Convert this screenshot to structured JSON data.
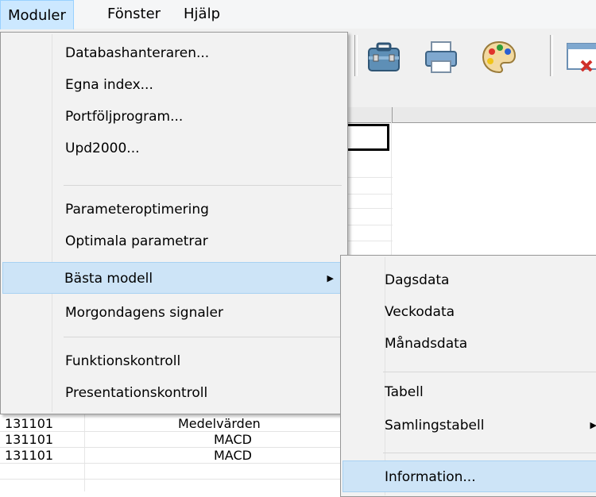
{
  "menubar": {
    "items": [
      {
        "label": "Moduler",
        "active": true
      },
      {
        "label": "Fönster",
        "active": false
      },
      {
        "label": "Hjälp",
        "active": false
      }
    ]
  },
  "toolbar": {
    "icons": [
      "toolbox-icon",
      "printer-icon",
      "palette-icon",
      "window-close-icon"
    ]
  },
  "dropdown": {
    "items": [
      {
        "label": "Databashanteraren..."
      },
      {
        "label": "Egna index..."
      },
      {
        "label": "Portföljprogram..."
      },
      {
        "label": "Upd2000..."
      },
      {
        "label": "Parameteroptimering"
      },
      {
        "label": "Optimala parametrar"
      },
      {
        "label": "Bästa modell",
        "highlighted": true,
        "has_submenu": true
      },
      {
        "label": "Morgondagens signaler"
      },
      {
        "label": "Funktionskontroll"
      },
      {
        "label": "Presentationskontroll"
      }
    ]
  },
  "submenu": {
    "items": [
      {
        "label": "Dagsdata"
      },
      {
        "label": "Veckodata"
      },
      {
        "label": "Månadsdata"
      },
      {
        "label": "Tabell"
      },
      {
        "label": "Samlingstabell",
        "has_submenu": true
      },
      {
        "label": "Information...",
        "highlighted": true
      }
    ]
  },
  "grid_rows": [
    {
      "date": "131101",
      "name": "Medelvärden"
    },
    {
      "date": "131101",
      "name": "MACD"
    },
    {
      "date": "131101",
      "name": "MACD"
    }
  ],
  "colors": {
    "menubar_bg": "#f5f6f7",
    "active_bg": "#cce8ff",
    "menu_bg": "#f2f2f2",
    "highlight_bg": "#cde4f7"
  }
}
